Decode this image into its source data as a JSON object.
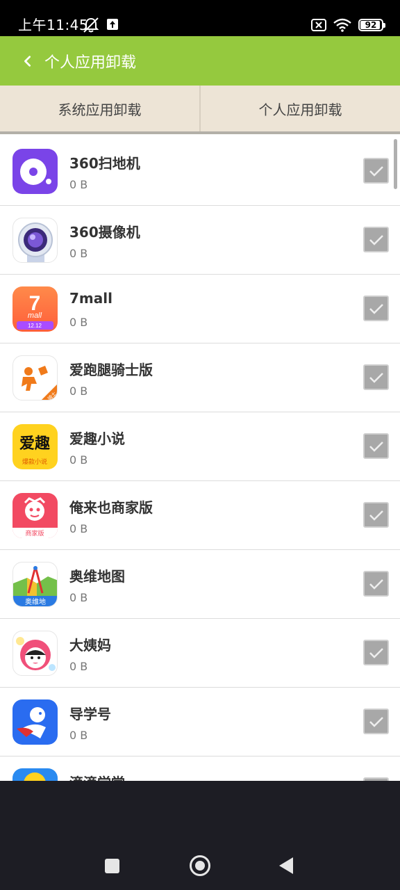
{
  "status_bar": {
    "time": "上午11:45",
    "battery": "92",
    "battery_level": 0.92
  },
  "header": {
    "title": "个人应用卸载"
  },
  "tabs": [
    {
      "label": "系统应用卸载"
    },
    {
      "label": "个人应用卸载"
    }
  ],
  "apps": [
    {
      "name": "360扫地机",
      "size": "0 B",
      "icon": "vacuum-robot-icon",
      "checked": true
    },
    {
      "name": "360摄像机",
      "size": "0 B",
      "icon": "camera-icon",
      "checked": true
    },
    {
      "name": "7mall",
      "size": "0 B",
      "icon": "seven-mall-icon",
      "icon_text": "7",
      "icon_sub": "mall",
      "icon_badge": "12.12",
      "checked": true
    },
    {
      "name": "爱跑腿骑士版",
      "size": "0 B",
      "icon": "runner-icon",
      "icon_badge": "骑士",
      "checked": true
    },
    {
      "name": "爱趣小说",
      "size": "0 B",
      "icon": "novel-icon",
      "icon_text": "爱趣",
      "icon_sub": "爆款小说",
      "checked": true
    },
    {
      "name": "俺来也商家版",
      "size": "0 B",
      "icon": "monkey-icon",
      "icon_sub": "商家版",
      "checked": true
    },
    {
      "name": "奥维地图",
      "size": "0 B",
      "icon": "map-icon",
      "icon_sub": "奥维地",
      "checked": true
    },
    {
      "name": "大姨妈",
      "size": "0 B",
      "icon": "doll-icon",
      "checked": true
    },
    {
      "name": "导学号",
      "size": "0 B",
      "icon": "hero-icon",
      "checked": true
    },
    {
      "name": "滴滴学堂",
      "size": "",
      "icon": "smiley-icon",
      "checked": true
    }
  ],
  "colors": {
    "header": "#95c93e",
    "tab_bg": "#ede4d6",
    "nav_bg": "#1d1d24"
  }
}
